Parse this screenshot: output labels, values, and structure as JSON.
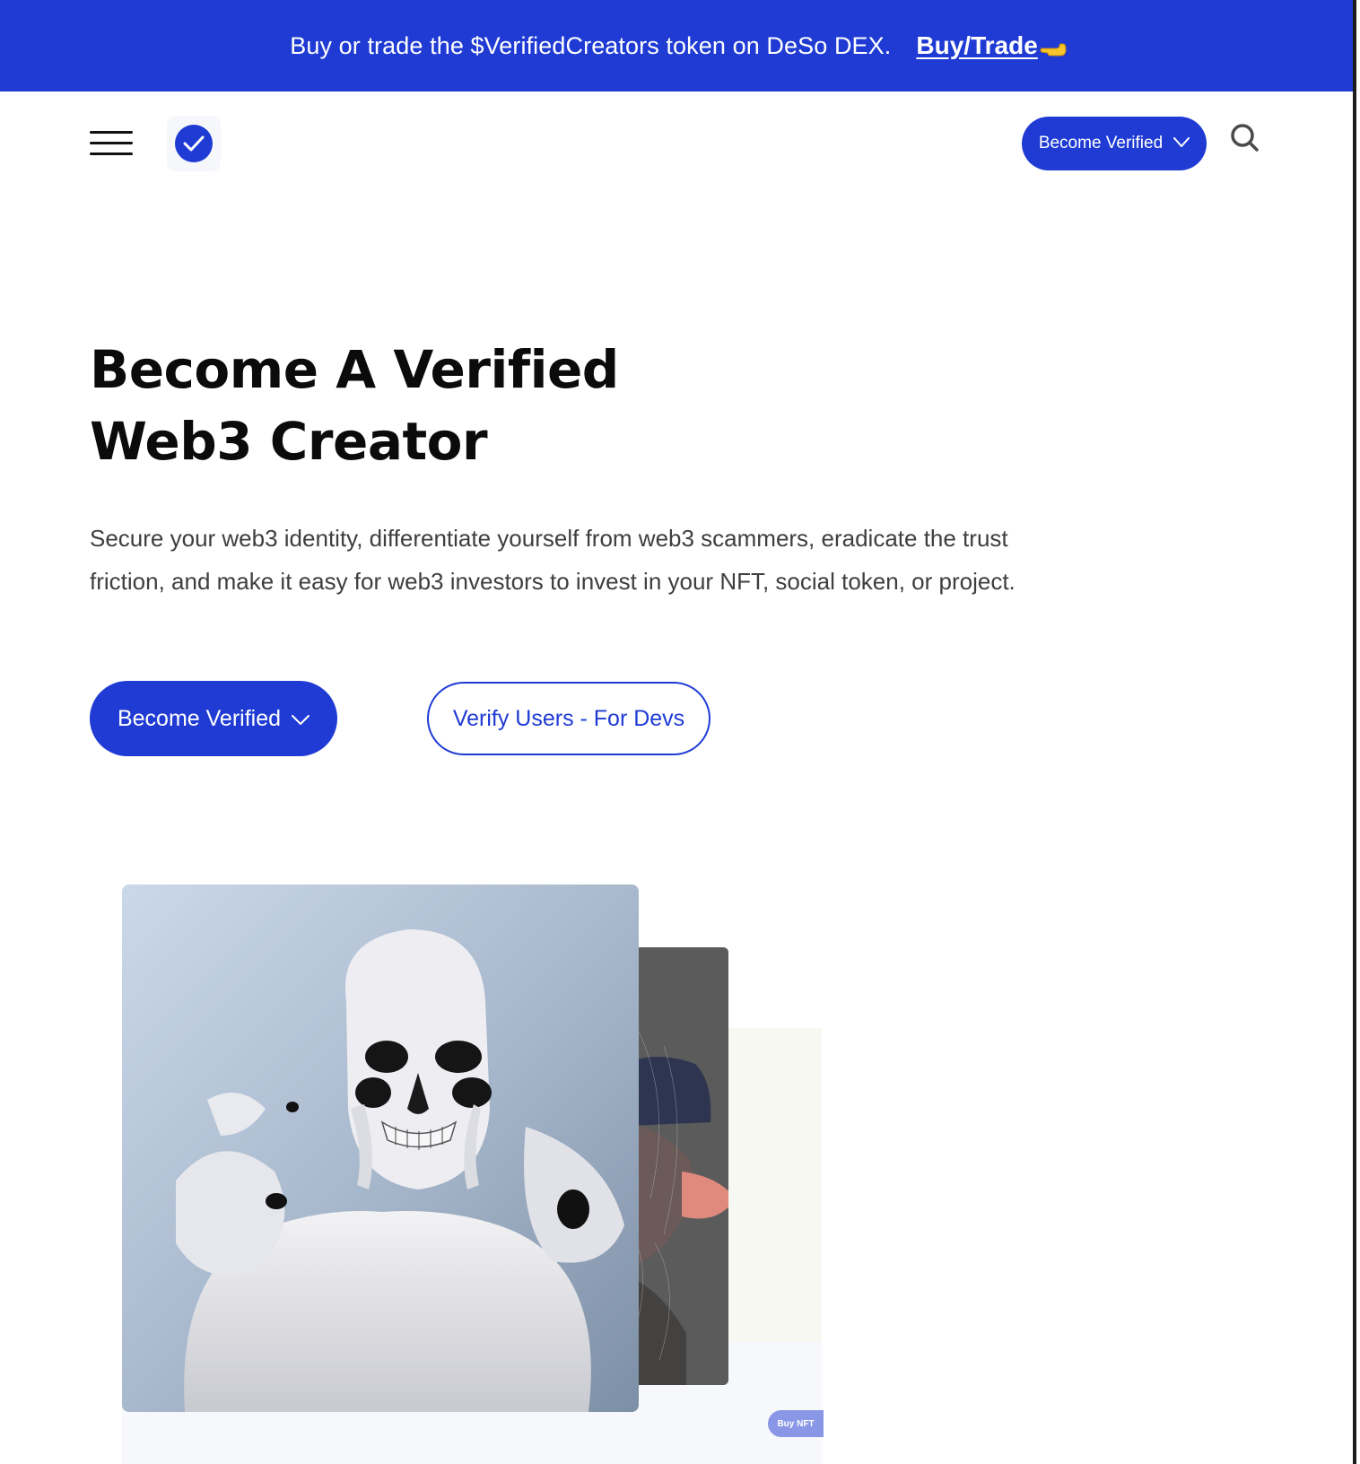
{
  "banner": {
    "text": "Buy or trade the $VerifiedCreators token on DeSo DEX.",
    "link_label": "Buy/Trade",
    "link_icon": "pointing-hand-icon",
    "background": "#1f3bd4"
  },
  "nav": {
    "menu_icon": "hamburger-menu-icon",
    "logo_icon": "verified-check-icon",
    "cta_label": "Become Verified",
    "cta_icon": "chevron-down-icon",
    "search_icon": "search-icon"
  },
  "hero": {
    "title_line1": "Become A Verified",
    "title_line2": "Web3 Creator",
    "subtitle_line1": "Secure your web3 identity, differentiate yourself from web3 scammers, eradicate the trust",
    "subtitle_line2": "friction, and make it easy for web3 investors to invest in your NFT, social token, or project.",
    "primary_button_label": "Become Verified",
    "secondary_button_label": "Verify Users - For Devs"
  },
  "cards": {
    "buy_nft_label": "Buy NFT"
  },
  "colors": {
    "accent": "#1f3bd4",
    "text": "#0b0b0b",
    "muted_text": "#3e3e3e"
  }
}
